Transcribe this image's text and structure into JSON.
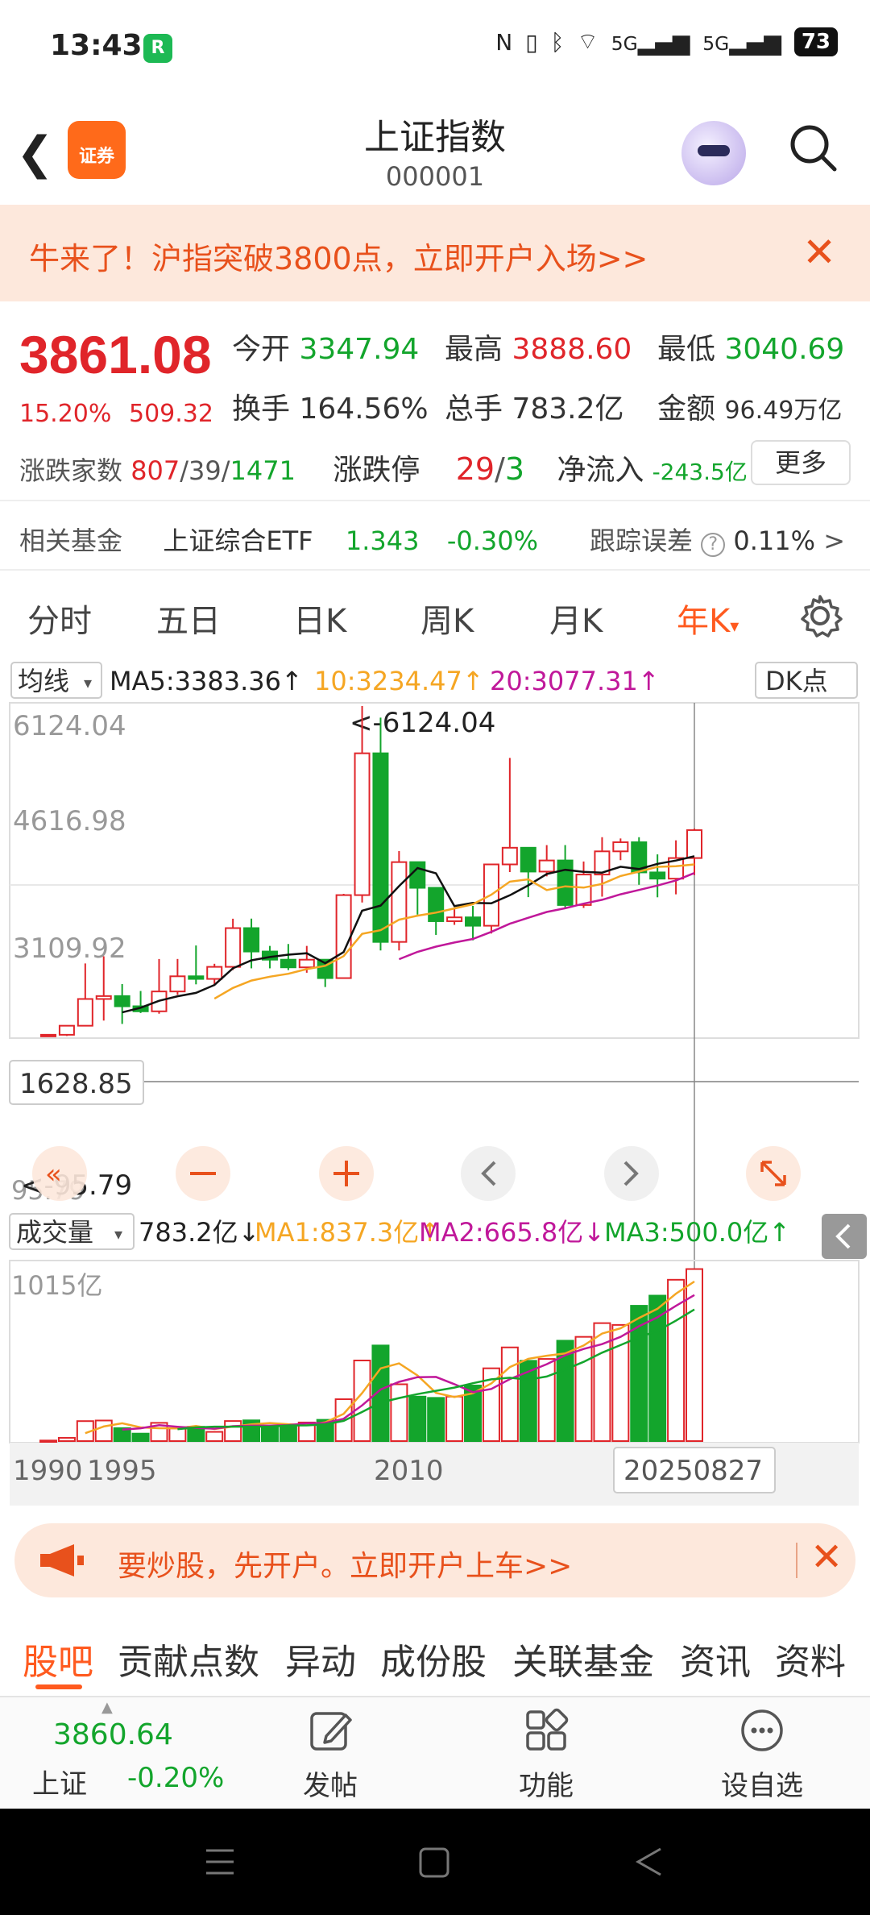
{
  "status": {
    "time": "13:43",
    "app_badge": "R",
    "net1": "5G",
    "net2": "5G",
    "battery": "73"
  },
  "nav": {
    "brand": "证券",
    "title": "上证指数",
    "code": "000001"
  },
  "promo": {
    "text": "牛来了！沪指突破3800点，立即开户入场>>"
  },
  "quote": {
    "price": "3861.08",
    "pct": "15.20%",
    "change": "509.32",
    "open_k": "今开",
    "open_v": "3347.94",
    "high_k": "最高",
    "high_v": "3888.60",
    "low_k": "最低",
    "low_v": "3040.69",
    "turnover_k": "换手",
    "turnover_v": "164.56%",
    "volume_k": "总手",
    "volume_v": "783.2亿",
    "amount_k": "金额",
    "amount_v": "96.49万亿",
    "breadth_k": "涨跌家数",
    "breadth_up": "807",
    "breadth_flat": "39",
    "breadth_down": "1471",
    "limit_k": "涨跌停",
    "limit_up": "29",
    "limit_down": "3",
    "netflow_k": "净流入",
    "netflow_v": "-243.5亿",
    "more": "更多"
  },
  "fund": {
    "label": "相关基金",
    "name": "上证综合ETF",
    "price": "1.343",
    "pct": "-0.30%",
    "track_label": "跟踪误差",
    "track_v": "0.11%",
    "arrow": ">"
  },
  "ktabs": [
    "分时",
    "五日",
    "日K",
    "周K",
    "月K",
    "年K"
  ],
  "chart": {
    "ma_toggle": "均线",
    "ma5": "MA5:3383.36",
    "ma10": "10:3234.47",
    "ma20": "20:3077.31",
    "dk": "DK点",
    "y_labels": [
      "6124.04",
      "4616.98",
      "3109.92",
      "1628.85",
      "95.79"
    ],
    "max_annotation": "<-6124.04",
    "min_annotation": "<-95.79",
    "vol_toggle": "成交量",
    "vol_value": "783.2亿",
    "vol_ma1": "MA1:837.3亿",
    "vol_ma2": "MA2:665.8亿",
    "vol_ma3": "MA3:500.0亿",
    "vol_max": "1015亿",
    "x_labels": [
      "1990",
      "1995",
      "2010",
      "20250827"
    ],
    "colors": {
      "up": "#e0252a",
      "down": "#13a52c",
      "ma5": "#111111",
      "ma10": "#f5a623",
      "ma20": "#c0189a"
    }
  },
  "chart_data": {
    "type": "candlestick",
    "ylim": [
      95.79,
      6124.04
    ],
    "candles": [
      {
        "o": 100,
        "h": 128,
        "l": 96,
        "c": 127
      },
      {
        "o": 127,
        "h": 292,
        "l": 105,
        "c": 292
      },
      {
        "o": 292,
        "h": 1429,
        "l": 287,
        "c": 780
      },
      {
        "o": 780,
        "h": 1558,
        "l": 386,
        "c": 833
      },
      {
        "o": 833,
        "h": 1052,
        "l": 325,
        "c": 647
      },
      {
        "o": 647,
        "h": 926,
        "l": 524,
        "c": 555
      },
      {
        "o": 555,
        "h": 1510,
        "l": 512,
        "c": 917
      },
      {
        "o": 917,
        "h": 1510,
        "l": 855,
        "c": 1194
      },
      {
        "o": 1194,
        "h": 1756,
        "l": 1047,
        "c": 1146
      },
      {
        "o": 1146,
        "h": 1422,
        "l": 1047,
        "c": 1366
      },
      {
        "o": 1366,
        "h": 2245,
        "l": 1307,
        "c": 2073
      },
      {
        "o": 2073,
        "h": 2246,
        "l": 1339,
        "c": 1646
      },
      {
        "o": 1646,
        "h": 1748,
        "l": 1339,
        "c": 1497
      },
      {
        "o": 1497,
        "h": 1783,
        "l": 1307,
        "c": 1357
      },
      {
        "o": 1357,
        "h": 1748,
        "l": 1259,
        "c": 1497
      },
      {
        "o": 1497,
        "h": 1507,
        "l": 998,
        "c": 1161
      },
      {
        "o": 1161,
        "h": 2698,
        "l": 1161,
        "c": 2675
      },
      {
        "o": 2675,
        "h": 6124,
        "l": 2541,
        "c": 5262
      },
      {
        "o": 5262,
        "h": 5913,
        "l": 1665,
        "c": 1821
      },
      {
        "o": 1821,
        "h": 3478,
        "l": 1665,
        "c": 3277
      },
      {
        "o": 3277,
        "h": 3186,
        "l": 2319,
        "c": 2808
      },
      {
        "o": 2808,
        "h": 2478,
        "l": 1949,
        "c": 2199
      },
      {
        "o": 2199,
        "h": 2444,
        "l": 2132,
        "c": 2269
      },
      {
        "o": 2269,
        "h": 2478,
        "l": 1850,
        "c": 2116
      },
      {
        "o": 2116,
        "h": 3239,
        "l": 1974,
        "c": 3235
      },
      {
        "o": 3235,
        "h": 5178,
        "l": 3095,
        "c": 3539
      },
      {
        "o": 3539,
        "h": 3544,
        "l": 2638,
        "c": 3104
      },
      {
        "o": 3104,
        "h": 3587,
        "l": 3017,
        "c": 3307
      },
      {
        "o": 3307,
        "h": 3587,
        "l": 2449,
        "c": 2494
      },
      {
        "o": 2494,
        "h": 3288,
        "l": 2441,
        "c": 3050
      },
      {
        "o": 3050,
        "h": 3731,
        "l": 2646,
        "c": 3473
      },
      {
        "o": 3473,
        "h": 3708,
        "l": 3312,
        "c": 3640
      },
      {
        "o": 3640,
        "h": 3731,
        "l": 2863,
        "c": 3089
      },
      {
        "o": 3089,
        "h": 3418,
        "l": 2635,
        "c": 2975
      },
      {
        "o": 2975,
        "h": 3674,
        "l": 2689,
        "c": 3351
      },
      {
        "o": 3351,
        "h": 3888,
        "l": 3040,
        "c": 3861
      }
    ],
    "volume_max": 1015
  },
  "bottom_banner": {
    "text": "要炒股，先开户。立即开户上车>>"
  },
  "btabs": [
    "股吧",
    "贡献点数",
    "异动",
    "成份股",
    "关联基金",
    "资讯",
    "资料"
  ],
  "bottombar": {
    "price": "3860.64",
    "name": "上证",
    "pct": "-0.20%",
    "post": "发帖",
    "func": "功能",
    "watch": "设自选"
  }
}
